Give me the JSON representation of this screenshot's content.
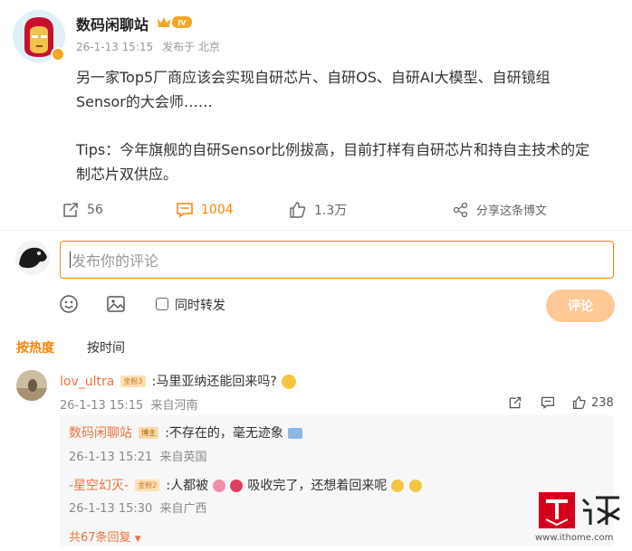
{
  "post": {
    "author": "数码闲聊站",
    "level_badge": "IV",
    "timestamp": "26-1-13 15:15",
    "location": "发布于 北京",
    "content_line1": "另一家Top5厂商应该会实现自研芯片、自研OS、自研AI大模型、自研镜组",
    "content_line2": "Sensor的大会师……",
    "content_line3": "Tips：今年旗舰的自研Sensor比例拔高，目前打样有自研芯片和持自主技术的定",
    "content_line4": "制芯片双供应。"
  },
  "actions": {
    "repost_count": "56",
    "comment_count": "1004",
    "like_count": "1.3万",
    "share_label": "分享这条博文"
  },
  "composer": {
    "placeholder": "发布你的评论",
    "repost_label": "同时转发",
    "submit_label": "评论"
  },
  "sort": {
    "hot": "按热度",
    "time": "按时间"
  },
  "comments": [
    {
      "name": "lov_ultra",
      "badge": "金粉3",
      "text": ":马里亚纳还能回来吗?",
      "timestamp": "26-1-13 15:15",
      "location": "来自河南",
      "likes": "238",
      "replies": [
        {
          "name": "数码闲聊站",
          "badge": "博主",
          "text": ":不存在的，毫无迹象",
          "timestamp": "26-1-13 15:21",
          "location": "来自英国"
        },
        {
          "name": "-星空幻灭-",
          "badge": "金粉2",
          "text_a": ":人都被",
          "text_b": "吸收完了，还想着回来呢",
          "timestamp": "26-1-13 15:30",
          "location": "来自广西"
        }
      ],
      "more_replies": "共67条回复"
    }
  ],
  "watermark": {
    "url": "www.ithome.com"
  },
  "colors": {
    "accent": "#ff8200",
    "name": "#eb7340",
    "submit_disabled": "#ffc996"
  }
}
